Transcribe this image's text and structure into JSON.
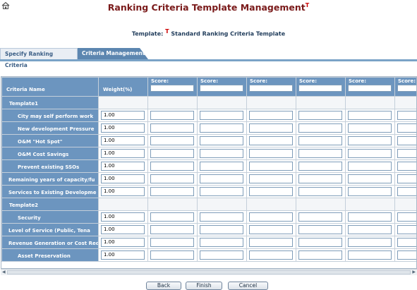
{
  "header": {
    "title": "Ranking Criteria Template Management",
    "title_marker": "T",
    "template_label": "Template:",
    "template_marker": "T",
    "template_name": "Standard Ranking Criteria Template"
  },
  "tabs": [
    {
      "label": "Specify Ranking Criteria",
      "active": false
    },
    {
      "label": "Criteria Management",
      "active": true
    }
  ],
  "grid": {
    "columns": {
      "criteria_name": "Criteria Name",
      "weight": "Weight(%)",
      "score": "Score:"
    },
    "rows": [
      {
        "type": "group",
        "name": "Template1"
      },
      {
        "type": "item",
        "name": "City may self perform work",
        "weight": "1.00"
      },
      {
        "type": "item",
        "name": "New development Pressure",
        "weight": "1.00"
      },
      {
        "type": "item",
        "name": "O&M \"Hot Spot\"",
        "weight": "1.00"
      },
      {
        "type": "item",
        "name": "O&M Cost Savings",
        "weight": "1.00"
      },
      {
        "type": "item",
        "name": "Prevent existing SSOs",
        "weight": "1.00"
      },
      {
        "type": "item",
        "name": "Remaining years of capacity/fu",
        "weight": "1.00",
        "flush": true
      },
      {
        "type": "item",
        "name": "Services to Existing Developme",
        "weight": "1.00",
        "flush": true
      },
      {
        "type": "group",
        "name": "Template2"
      },
      {
        "type": "item",
        "name": "Security",
        "weight": "1.00"
      },
      {
        "type": "item",
        "name": "Level of Service (Public, Tena",
        "weight": "1.00",
        "flush": true
      },
      {
        "type": "item",
        "name": "Revenue Generation or Cost Red",
        "weight": "1.00",
        "flush": true
      },
      {
        "type": "item",
        "name": "Asset Preservation",
        "weight": "1.00"
      }
    ]
  },
  "buttons": {
    "back": "Back",
    "finish": "Finish",
    "cancel": "Cancel"
  },
  "colors": {
    "title": "#7a1a1a",
    "grid_header": "#6c95bf",
    "active_tab": "#5c86b0"
  }
}
